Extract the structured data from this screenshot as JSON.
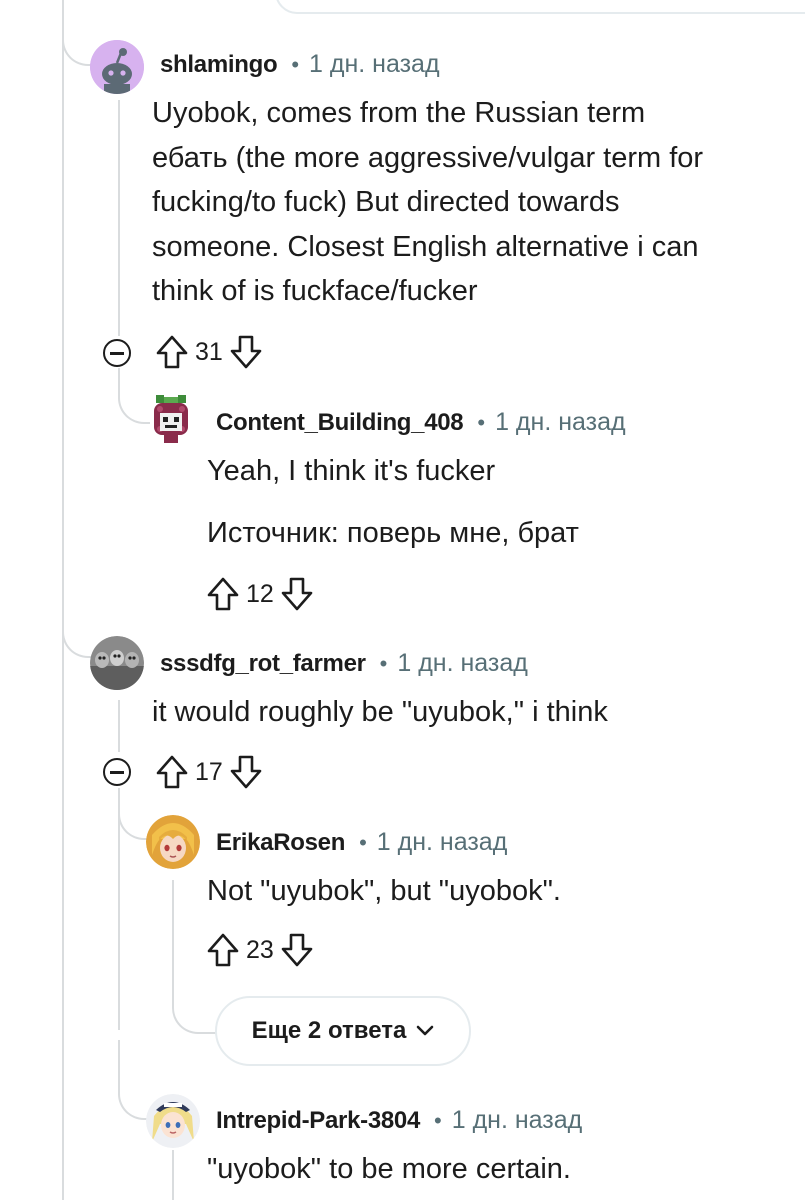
{
  "comments": [
    {
      "author": "shlamingo",
      "time": "1 дн. назад",
      "lines": [
        "Uyobok, comes from the Russian term",
        "ебать (the more aggressive/vulgar term for",
        "fucking/to fuck) But directed towards",
        "someone. Closest English alternative i can",
        "think of is fuckface/fucker"
      ],
      "votes": "31",
      "avatar_icon": "reddit-snoo-icon"
    },
    {
      "author": "Content_Building_408",
      "time": "1 дн. назад",
      "lines": [
        "Yeah, I think it's fucker"
      ],
      "lines2": [
        "Источник: поверь мне, брат"
      ],
      "votes": "12",
      "avatar_icon": "raspberry-avatar-icon"
    },
    {
      "author": "sssdfg_rot_farmer",
      "time": "1 дн. назад",
      "lines": [
        "it would roughly be \"uyubok,\" i think"
      ],
      "votes": "17",
      "avatar_icon": "photo-avatar-icon"
    },
    {
      "author": "ErikaRosen",
      "time": "1 дн. назад",
      "lines": [
        "Not \"uyubok\", but \"uyobok\"."
      ],
      "votes": "23",
      "avatar_icon": "anime-avatar-icon"
    },
    {
      "author": "Intrepid-Park-3804",
      "time": "1 дн. назад",
      "lines": [
        "\"uyobok\" to be more certain."
      ],
      "avatar_icon": "anime-avatar-icon"
    }
  ],
  "more_replies": {
    "label": "Еще 2 ответа",
    "icon": "chevron-down-icon"
  },
  "separator": "•",
  "colors": {
    "thread_line": "#d9dcde",
    "meta": "#576f76",
    "text": "#1c1c1c"
  }
}
